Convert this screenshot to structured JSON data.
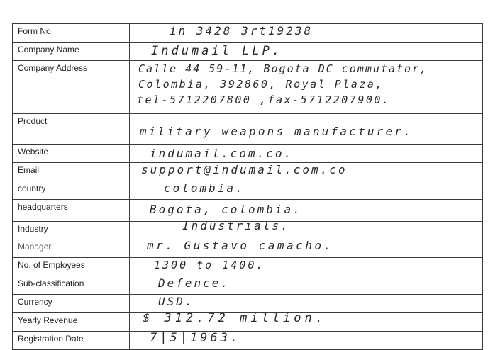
{
  "form": {
    "rows": [
      {
        "label": "Form No.",
        "value": "in 3428 3rt19238"
      },
      {
        "label": "Company Name",
        "value": "Indumail  LLP."
      },
      {
        "label": "Company Address",
        "lines": [
          "Calle 44 59-11, Bogota DC commutator,",
          "Colombia, 392860, Royal Plaza,",
          "tel-5712207800 ,fax-5712207900."
        ]
      },
      {
        "label": "Product",
        "value": "military  weapons  manufacturer."
      },
      {
        "label": "Website",
        "value": "indumail.com.co."
      },
      {
        "label": "Email",
        "value": "support@indumail.com.co"
      },
      {
        "label": "country",
        "value": "colombia."
      },
      {
        "label": "headquarters",
        "value": "Bogota, colombia."
      },
      {
        "label": "Industry",
        "value": "Industrials."
      },
      {
        "label": "Manager",
        "value": "mr. Gustavo  camacho."
      },
      {
        "label": "No. of Employees",
        "value": "1300 to 1400."
      },
      {
        "label": "Sub-classification",
        "value": "Defence."
      },
      {
        "label": "Currency",
        "value": "USD."
      },
      {
        "label": "Yearly Revenue",
        "value": "$ 312.72  million."
      },
      {
        "label": "Registration Date",
        "value": "7|5|1963."
      }
    ]
  }
}
